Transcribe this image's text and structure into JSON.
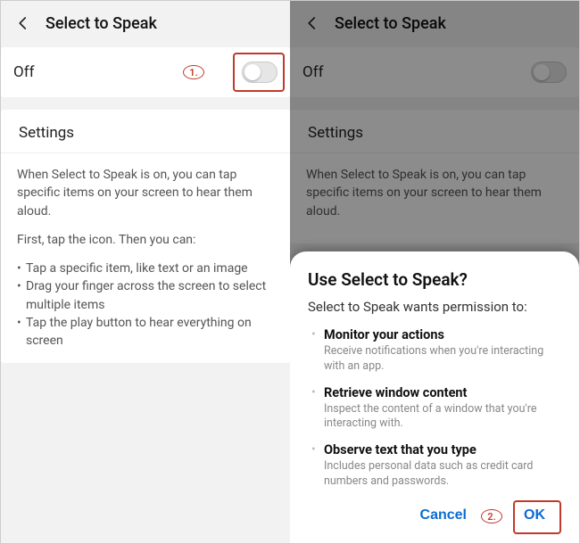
{
  "left": {
    "header": {
      "title": "Select to Speak"
    },
    "toggle_row": {
      "label": "Off",
      "state": "off",
      "annotation": "1."
    },
    "settings": {
      "heading": "Settings",
      "p1": "When Select to Speak is on, you can tap specific items on your screen to hear them aloud.",
      "p2": "First, tap the icon. Then you can:",
      "bullets": [
        "Tap a specific item, like text or an image",
        "Drag your finger across the screen to select multiple items",
        "Tap the play button to hear everything on screen"
      ]
    }
  },
  "right": {
    "header": {
      "title": "Select to Speak"
    },
    "toggle_row": {
      "label": "Off",
      "state": "off"
    },
    "settings": {
      "heading": "Settings",
      "p1": "When Select to Speak is on, you can tap specific items on your screen to hear them aloud."
    },
    "dialog": {
      "title": "Use Select to Speak?",
      "subtitle": "Select to Speak wants permission to:",
      "perms": [
        {
          "title": "Monitor your actions",
          "desc": "Receive notifications when you're interacting with an app."
        },
        {
          "title": "Retrieve window content",
          "desc": "Inspect the content of a window that you're interacting with."
        },
        {
          "title": "Observe text that you type",
          "desc": "Includes personal data such as credit card numbers and passwords."
        }
      ],
      "cancel": "Cancel",
      "ok": "OK",
      "annotation": "2."
    }
  }
}
